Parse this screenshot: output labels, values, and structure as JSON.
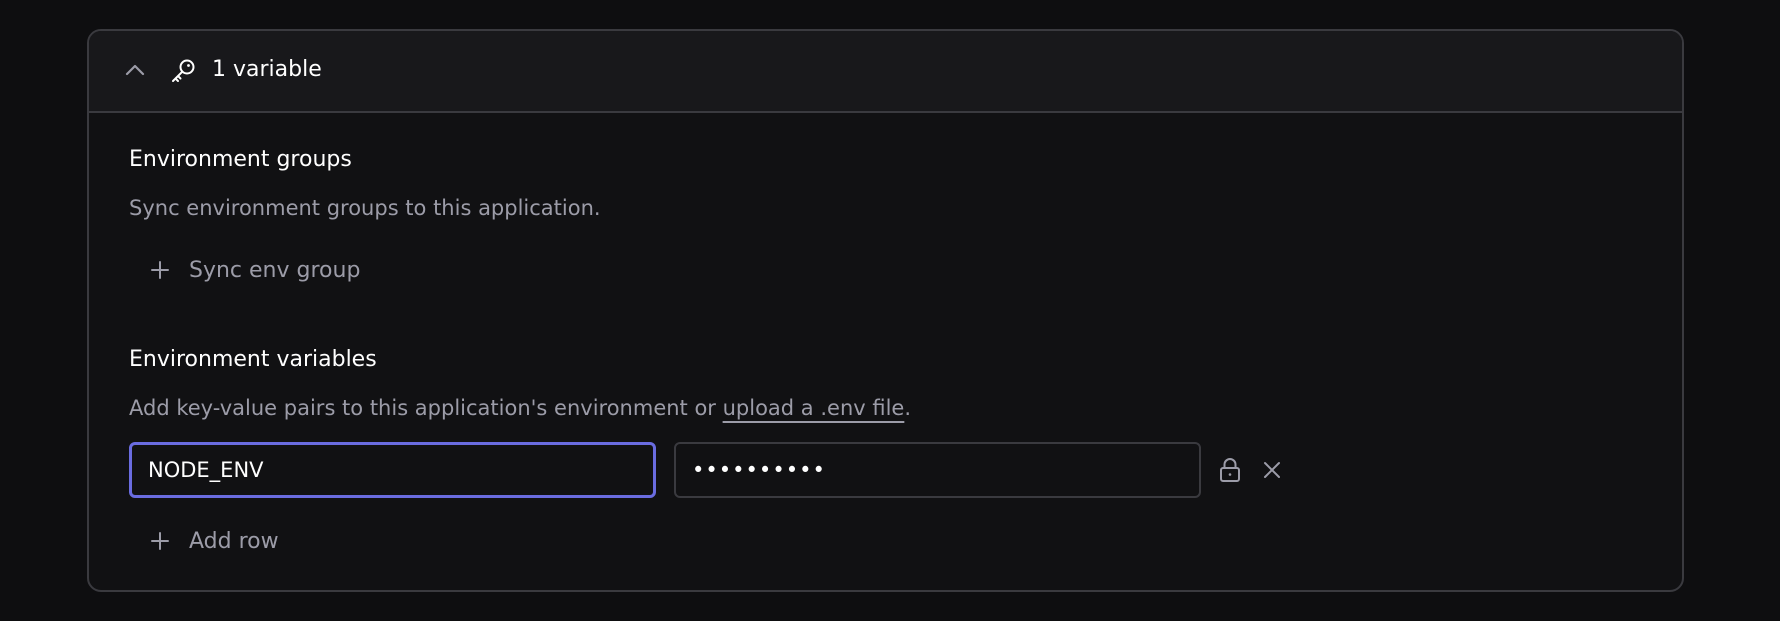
{
  "header": {
    "title": "1 variable",
    "expanded": true
  },
  "env_groups": {
    "title": "Environment groups",
    "description": "Sync environment groups to this application.",
    "sync_label": "Sync env group"
  },
  "env_vars": {
    "title": "Environment variables",
    "description_prefix": "Add key-value pairs to this application's environment or ",
    "upload_link": "upload a .env file",
    "description_suffix": ".",
    "rows": [
      {
        "key": "NODE_ENV",
        "value": "••••••••••"
      }
    ],
    "add_row_label": "Add row"
  },
  "colors": {
    "background": "#0e0e10",
    "panel": "#111113",
    "header": "#18181b",
    "border": "#3a3a3f",
    "focus": "#6a6ce0",
    "muted_text": "#9c9ca8",
    "text": "#ffffff"
  }
}
